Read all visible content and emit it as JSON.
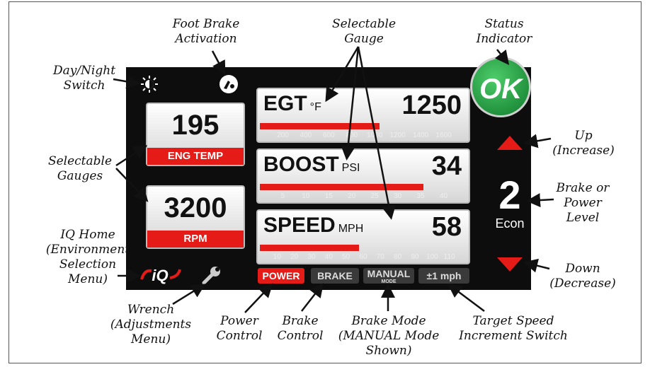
{
  "callouts": {
    "foot_brake": "Foot Brake\nActivation",
    "selectable_gauge": "Selectable\nGauge",
    "status_indicator": "Status\nIndicator",
    "day_night": "Day/Night\nSwitch",
    "up": "Up\n(Increase)",
    "selectable_gauges": "Selectable\nGauges",
    "brake_power_level": "Brake or\nPower\nLevel",
    "iq_home": "IQ Home\n(Environment\nSelection\nMenu)",
    "down": "Down\n(Decrease)",
    "wrench": "Wrench\n(Adjustments\nMenu)",
    "power_control": "Power\nControl",
    "brake_control": "Brake\nControl",
    "brake_mode": "Brake Mode\n(MANUAL Mode\nShown)",
    "target_speed": "Target Speed\nIncrement Switch"
  },
  "status": {
    "label": "OK",
    "color": "#1e9e3e"
  },
  "level": {
    "value": "2",
    "mode": "Econ"
  },
  "small_gauges": [
    {
      "value": "195",
      "label": "ENG TEMP"
    },
    {
      "value": "3200",
      "label": "RPM"
    }
  ],
  "gauges": [
    {
      "name": "EGT",
      "unit": "°F",
      "value": "1250",
      "fill": 0.58,
      "ticks": [
        "200",
        "400",
        "600",
        "800",
        "1000",
        "1200",
        "1400",
        "1600"
      ]
    },
    {
      "name": "BOOST",
      "unit": "PSI",
      "value": "34",
      "fill": 0.79,
      "ticks": [
        "5",
        "10",
        "15",
        "20",
        "25",
        "30",
        "35",
        "40"
      ]
    },
    {
      "name": "SPEED",
      "unit": "MPH",
      "value": "58",
      "fill": 0.48,
      "ticks": [
        "10",
        "20",
        "30",
        "40",
        "50",
        "60",
        "70",
        "80",
        "90",
        "100",
        "110"
      ]
    }
  ],
  "buttons": {
    "power": "POWER",
    "brake": "BRAKE",
    "manual": "MANUAL",
    "manual_sub": "MODE",
    "increment": "±1 mph"
  },
  "logo_text": "iQ",
  "colors": {
    "accent_red": "#e41b17",
    "screen_bg": "#0d0d0d"
  }
}
